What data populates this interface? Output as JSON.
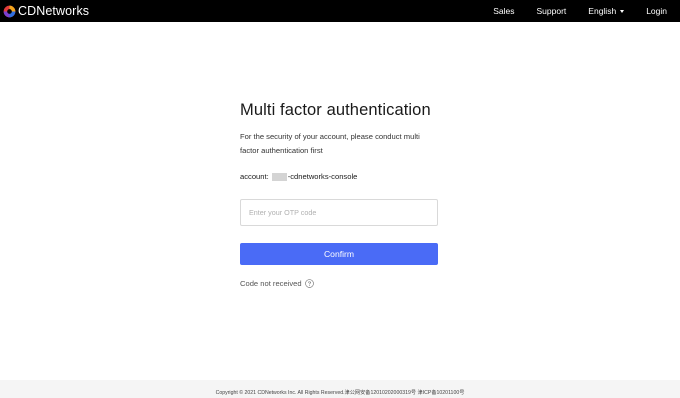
{
  "header": {
    "brand": "CDNetworks",
    "nav": {
      "sales": "Sales",
      "support": "Support",
      "language": "English",
      "login": "Login"
    }
  },
  "colors": {
    "topbar": "#000000",
    "primary_button": "#4a6bf6",
    "footer_bg": "#f5f5f5"
  },
  "mfa": {
    "title": "Multi factor authentication",
    "description": "For the security of your account, please conduct multi factor authentication first",
    "account_label": "account:",
    "account_value": "-cdnetworks-console",
    "otp_placeholder": "Enter your OTP code",
    "otp_value": "",
    "confirm_label": "Confirm",
    "code_not_received": "Code not received"
  },
  "footer": {
    "copyright": "Copyright © 2021 CDNetworks Inc. All Rights Reserved.津公网安备12010202000319号 津ICP备10201100号"
  }
}
